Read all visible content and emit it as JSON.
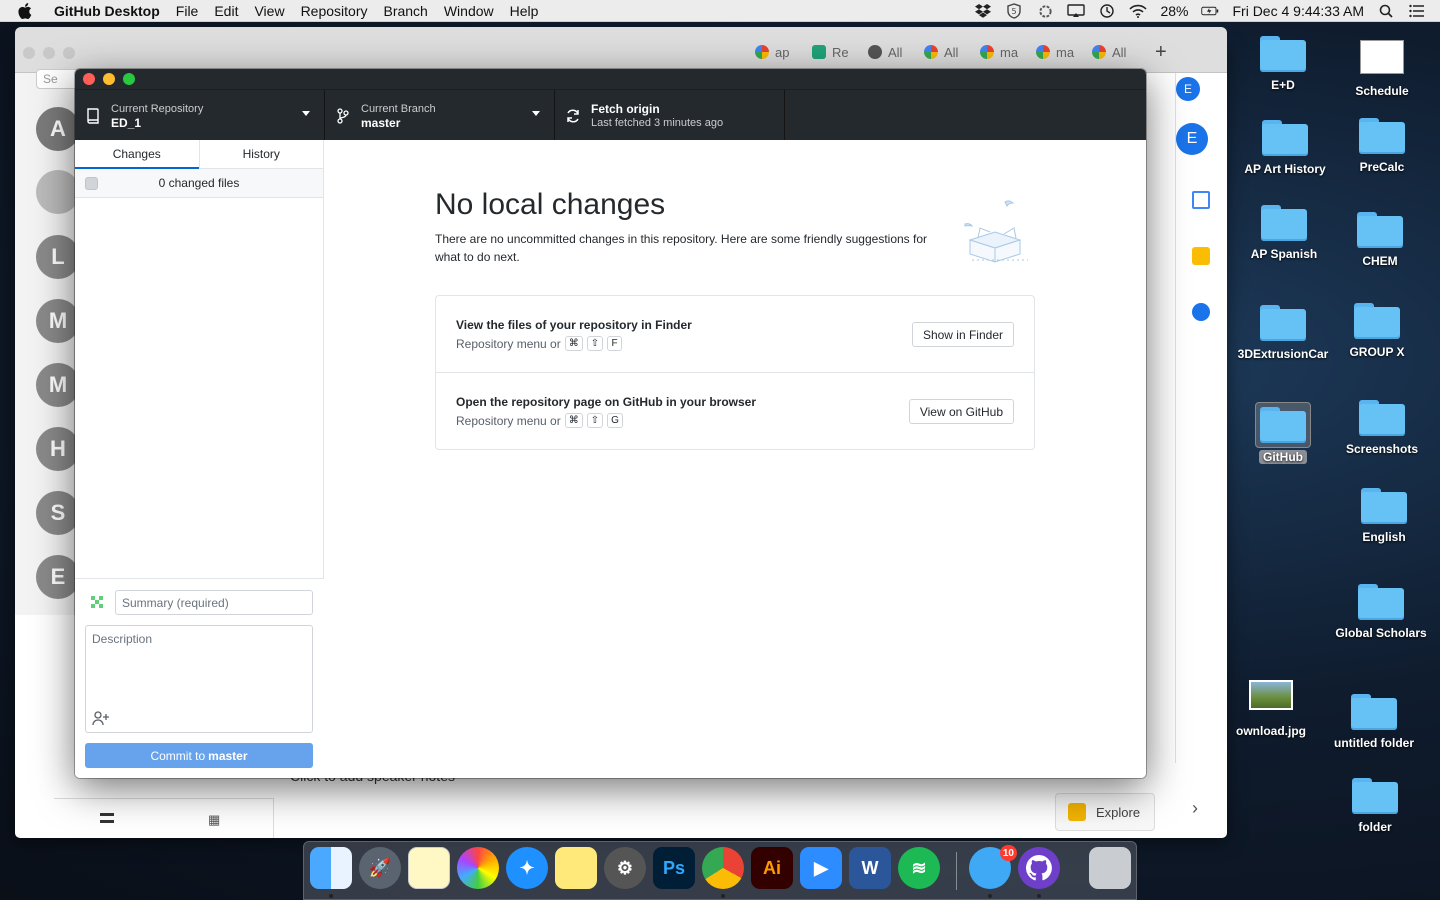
{
  "menubar": {
    "app_name": "GitHub Desktop",
    "menus": [
      "File",
      "Edit",
      "View",
      "Repository",
      "Branch",
      "Window",
      "Help"
    ],
    "battery": "28%",
    "clock": "Fri Dec 4  9:44:33 AM"
  },
  "browser_tabs": [
    "ap",
    "Re",
    "All",
    "All",
    "ma",
    "ma",
    "All"
  ],
  "browser": {
    "search_placeholder": "Se",
    "profile_initial": "E"
  },
  "slides_bg": {
    "avatars": [
      "A",
      "L",
      "M",
      "M",
      "H",
      "S",
      "E"
    ],
    "speaker_notes": "Click to add speaker notes",
    "explore_label": "Explore"
  },
  "toolbar": {
    "repo_label": "Current Repository",
    "repo_value": "ED_1",
    "branch_label": "Current Branch",
    "branch_value": "master",
    "fetch_label": "Fetch origin",
    "fetch_sub": "Last fetched 3 minutes ago"
  },
  "sidebar": {
    "tabs": [
      "Changes",
      "History"
    ],
    "changed_files": "0 changed files",
    "summary_placeholder": "Summary (required)",
    "description_placeholder": "Description",
    "commit_prefix": "Commit to",
    "commit_branch": "master"
  },
  "main": {
    "title": "No local changes",
    "description": "There are no uncommitted changes in this repository. Here are some friendly suggestions for what to do next.",
    "suggestions": [
      {
        "title": "View the files of your repository in Finder",
        "sub": "Repository menu or",
        "keys": [
          "⌘",
          "⇧",
          "F"
        ],
        "button": "Show in Finder"
      },
      {
        "title": "Open the repository page on GitHub in your browser",
        "sub": "Repository menu or",
        "keys": [
          "⌘",
          "⇧",
          "G"
        ],
        "button": "View on GitHub"
      }
    ]
  },
  "desktop": {
    "items": [
      "E+D",
      "Schedule",
      "AP Art History",
      "PreCalc",
      "AP Spanish",
      "CHEM",
      "3DExtrusionCar",
      "GROUP X",
      "GitHub",
      "Screenshots",
      "English",
      "Global Scholars",
      "ownload.jpg",
      "untitled folder",
      "folder"
    ]
  },
  "dock": {
    "messages_badge": "10"
  },
  "colors": {
    "toolbar_bg": "#24292e",
    "accent_blue": "#0366d6",
    "commit_button": "#66a3ec",
    "folder_blue": "#66c2f5"
  }
}
